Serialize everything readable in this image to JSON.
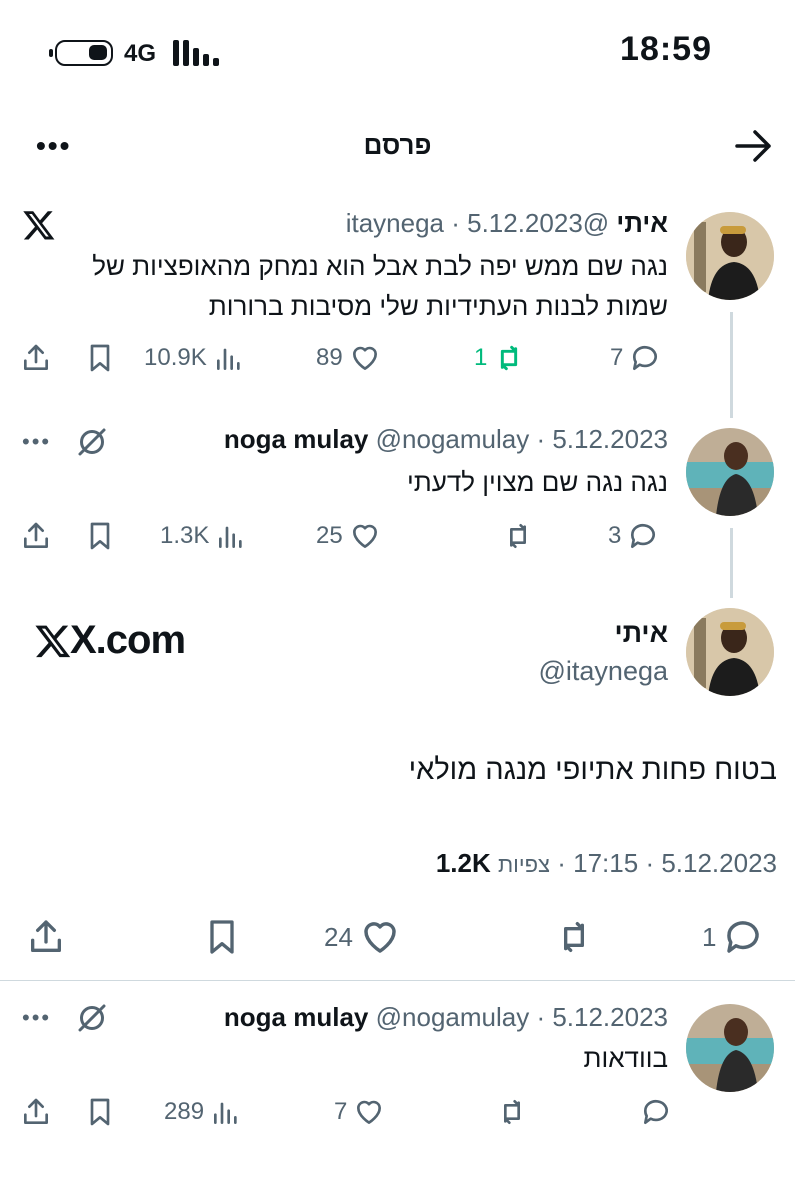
{
  "status_bar": {
    "time": "18:59",
    "network": "4G"
  },
  "header": {
    "title": "פרסם"
  },
  "tweets": [
    {
      "name": "איתי",
      "handle": "@itaynega",
      "date": "5.12.2023",
      "text": "נגה שם ממש יפה לבת אבל הוא נמחק מהאופציות של שמות לבנות העתידיות שלי מסיבות ברורות",
      "replies": "7",
      "retweets": "1",
      "likes": "89",
      "views": "10.9K"
    },
    {
      "name": "noga mulay",
      "handle": "@nogamulay",
      "date": "5.12.2023",
      "text": "נגה נגה שם מצוין לדעתי",
      "replies": "3",
      "retweets": "",
      "likes": "25",
      "views": "1.3K"
    }
  ],
  "main_tweet": {
    "name": "איתי",
    "handle": "@itaynega",
    "source": "X.com",
    "text": "בטוח פחות אתיופי מנגה מולאי",
    "date": "5.12.2023",
    "time": "17:15",
    "views_label": "צפיות",
    "views": "1.2K",
    "replies": "1",
    "likes": "24"
  },
  "reply_tweet": {
    "name": "noga mulay",
    "handle": "@nogamulay",
    "date": "5.12.2023",
    "text": "בוודאות",
    "replies": "",
    "likes": "7",
    "views": "289"
  },
  "colors": {
    "text": "#0f1419",
    "muted": "#536471",
    "retweet_active": "#00ba7c",
    "line": "#cfd9de"
  }
}
